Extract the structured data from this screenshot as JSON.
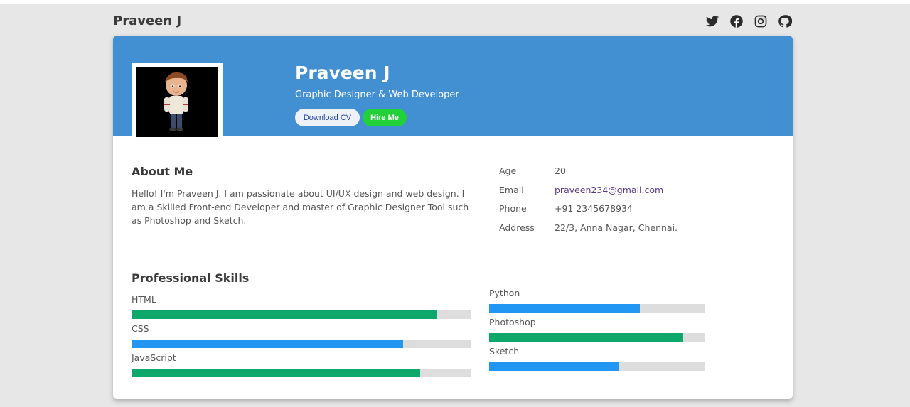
{
  "nav": {
    "brand": "Praveen J"
  },
  "social": [
    {
      "icon": "twitter-icon"
    },
    {
      "icon": "facebook-icon"
    },
    {
      "icon": "instagram-icon"
    },
    {
      "icon": "github-icon"
    }
  ],
  "header": {
    "name": "Praveen J",
    "subtitle": "Graphic Designer & Web Developer",
    "download_label": "Download CV",
    "hire_label": "Hire Me"
  },
  "about": {
    "title": "About Me",
    "text": "Hello! I'm Praveen J. I am passionate about UI/UX design and web design. I am a Skilled Front-end Developer and master of Graphic Designer Tool such as Photoshop and Sketch."
  },
  "info": [
    {
      "label": "Age",
      "value": "20"
    },
    {
      "label": "Email",
      "value": "praveen234@gmail.com"
    },
    {
      "label": "Phone",
      "value": "+91 2345678934"
    },
    {
      "label": "Address",
      "value": "22/3, Anna Nagar, Chennai."
    }
  ],
  "skills": {
    "title": "Professional Skills",
    "items": [
      {
        "name": "HTML",
        "percent": 90,
        "color": "#0ea86c"
      },
      {
        "name": "CSS",
        "percent": 80,
        "color": "#2196f3"
      },
      {
        "name": "JavaScript",
        "percent": 85,
        "color": "#0ea86c"
      },
      {
        "name": "Python",
        "percent": 70,
        "color": "#2196f3"
      },
      {
        "name": "Photoshop",
        "percent": 90,
        "color": "#0ea86c"
      },
      {
        "name": "Sketch",
        "percent": 60,
        "color": "#2196f3"
      }
    ]
  }
}
